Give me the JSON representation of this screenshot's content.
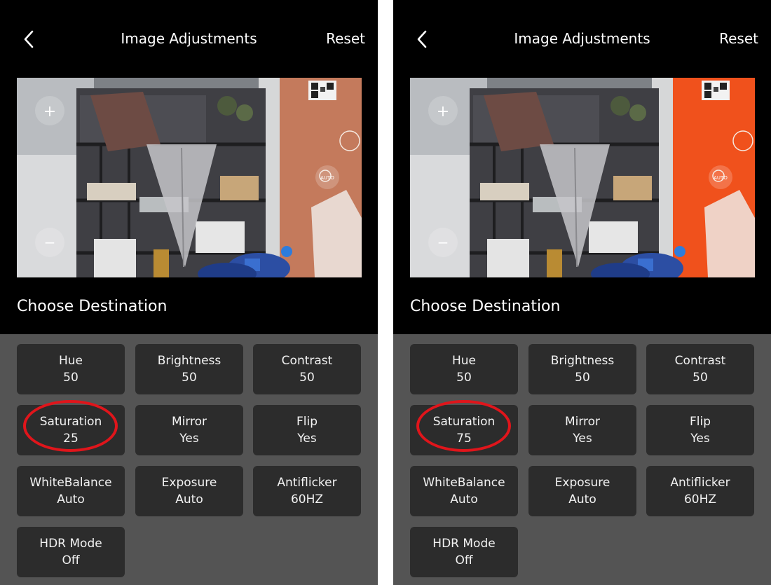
{
  "screens": [
    {
      "header": {
        "title": "Image Adjustments",
        "reset_label": "Reset"
      },
      "preview": {
        "zoom_in": "+",
        "zoom_out": "−",
        "auto_label": "AUTO"
      },
      "destination_label": "Choose Destination",
      "settings": [
        {
          "label": "Hue",
          "value": "50"
        },
        {
          "label": "Brightness",
          "value": "50"
        },
        {
          "label": "Contrast",
          "value": "50"
        },
        {
          "label": "Saturation",
          "value": "25"
        },
        {
          "label": "Mirror",
          "value": "Yes"
        },
        {
          "label": "Flip",
          "value": "Yes"
        },
        {
          "label": "WhiteBalance",
          "value": "Auto"
        },
        {
          "label": "Exposure",
          "value": "Auto"
        },
        {
          "label": "Antiflicker",
          "value": "60HZ"
        },
        {
          "label": "HDR Mode",
          "value": "Off"
        }
      ],
      "colors": {
        "wall": "#c47a5c",
        "highlight": "#e0151b"
      }
    },
    {
      "header": {
        "title": "Image Adjustments",
        "reset_label": "Reset"
      },
      "preview": {
        "zoom_in": "+",
        "zoom_out": "−",
        "auto_label": "AUTO"
      },
      "destination_label": "Choose Destination",
      "settings": [
        {
          "label": "Hue",
          "value": "50"
        },
        {
          "label": "Brightness",
          "value": "50"
        },
        {
          "label": "Contrast",
          "value": "50"
        },
        {
          "label": "Saturation",
          "value": "75"
        },
        {
          "label": "Mirror",
          "value": "Yes"
        },
        {
          "label": "Flip",
          "value": "Yes"
        },
        {
          "label": "WhiteBalance",
          "value": "Auto"
        },
        {
          "label": "Exposure",
          "value": "Auto"
        },
        {
          "label": "Antiflicker",
          "value": "60HZ"
        },
        {
          "label": "HDR Mode",
          "value": "Off"
        }
      ],
      "colors": {
        "wall": "#f0511c",
        "highlight": "#e0151b"
      }
    }
  ]
}
